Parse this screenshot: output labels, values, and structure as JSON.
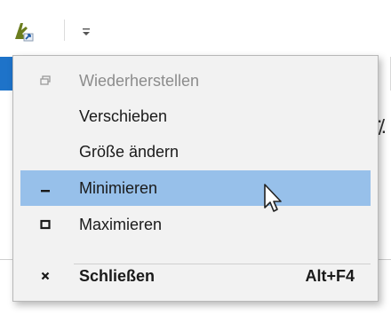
{
  "window": {
    "app_icon": "app-shortcut-icon",
    "qat_icon": "customize-quick-access-chevron-icon",
    "accent": "#1e73c9"
  },
  "system_menu": {
    "items": [
      {
        "label": "Wiederherstellen",
        "icon": "restore-icon",
        "enabled": false
      },
      {
        "label": "Verschieben",
        "icon": null,
        "enabled": true
      },
      {
        "label": "Größe ändern",
        "icon": null,
        "enabled": true
      },
      {
        "label": "Minimieren",
        "icon": "minimize-icon",
        "enabled": true,
        "highlighted": true
      },
      {
        "label": "Maximieren",
        "icon": "maximize-icon",
        "enabled": true
      },
      {
        "label": "Schließen",
        "icon": "close-icon",
        "enabled": true,
        "bold": true,
        "shortcut": "Alt+F4"
      }
    ],
    "highlight_color": "#97c0ea",
    "background": "#f2f2f2"
  }
}
